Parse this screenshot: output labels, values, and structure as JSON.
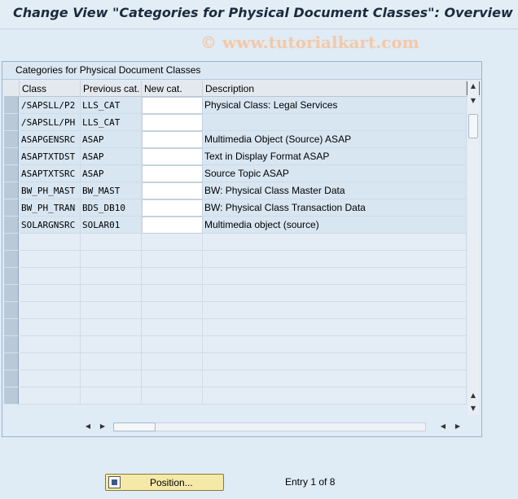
{
  "window": {
    "title": "Change View \"Categories for Physical Document Classes\": Overview"
  },
  "watermark": "© www.tutorialkart.com",
  "table": {
    "caption": "Categories for Physical Document Classes",
    "columns": [
      "Class",
      "Previous cat.",
      "New cat.",
      "Description"
    ],
    "rows": [
      {
        "class": "/SAPSLL/P2",
        "previous": "LLS_CAT",
        "new": "",
        "description": "Physical Class: Legal Services"
      },
      {
        "class": "/SAPSLL/PH",
        "previous": "LLS_CAT",
        "new": "",
        "description": ""
      },
      {
        "class": "ASAPGENSRC",
        "previous": "ASAP",
        "new": "",
        "description": "Multimedia Object (Source) ASAP"
      },
      {
        "class": "ASAPTXTDST",
        "previous": "ASAP",
        "new": "",
        "description": "Text in Display Format ASAP"
      },
      {
        "class": "ASAPTXTSRC",
        "previous": "ASAP",
        "new": "",
        "description": "Source Topic ASAP"
      },
      {
        "class": "BW_PH_MAST",
        "previous": "BW_MAST",
        "new": "",
        "description": "BW: Physical Class Master Data"
      },
      {
        "class": "BW_PH_TRAN",
        "previous": "BDS_DB10",
        "new": "",
        "description": "BW: Physical Class Transaction Data"
      },
      {
        "class": "SOLARGNSRC",
        "previous": "SOLAR01",
        "new": "",
        "description": "Multimedia object (source)"
      }
    ],
    "empty_rows": 10
  },
  "footer": {
    "position_button": "Position...",
    "entry_status": "Entry 1 of 8"
  },
  "icons": {
    "config": "table-settings-icon",
    "position": "position-icon"
  }
}
